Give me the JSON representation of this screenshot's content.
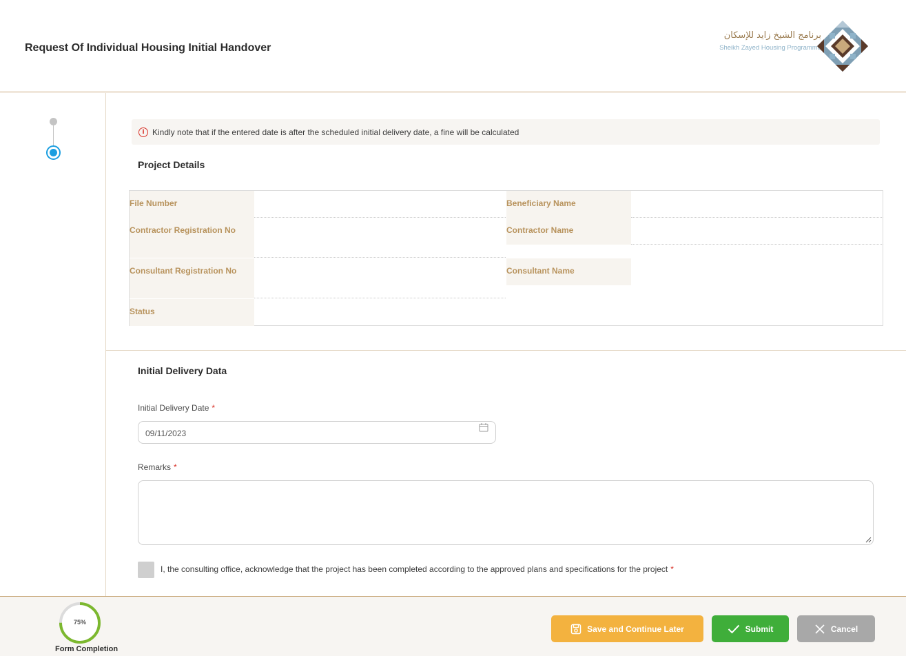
{
  "header": {
    "title": "Request Of Individual Housing Initial Handover",
    "logo_arabic": "برنامج الشيخ زايد للإسكان",
    "logo_english": "Sheikh Zayed Housing Programme"
  },
  "stepper": {
    "steps": [
      "step-1",
      "step-2"
    ],
    "current": 2
  },
  "notice": {
    "text": "Kindly note that if the entered date is after the scheduled initial delivery date, a fine will be calculated",
    "icon": "info-icon"
  },
  "project_details": {
    "title": "Project Details",
    "fields": {
      "file_number": {
        "label": "File Number",
        "value": ""
      },
      "beneficiary_name": {
        "label": "Beneficiary Name",
        "value": ""
      },
      "contractor_registration_no": {
        "label": "Contractor Registration No",
        "value": ""
      },
      "contractor_name": {
        "label": "Contractor Name",
        "value": ""
      },
      "consultant_registration_no": {
        "label": "Consultant Registration No",
        "value": ""
      },
      "consultant_name": {
        "label": "Consultant Name",
        "value": ""
      },
      "status": {
        "label": "Status",
        "value": ""
      }
    }
  },
  "initial_delivery": {
    "title": "Initial Delivery Data",
    "date_label": "Initial Delivery Date",
    "date_value": "09/11/2023",
    "remarks_label": "Remarks",
    "remarks_value": "",
    "required_mark": "*",
    "acknowledge_text": "I, the consulting office, acknowledge that the project has been completed according to the approved plans and specifications for the project",
    "acknowledge_checked": false
  },
  "footer": {
    "progress_percent": 75,
    "progress_label": "75%",
    "progress_caption": "Form Completion",
    "save_label": "Save and Continue Later",
    "submit_label": "Submit",
    "cancel_label": "Cancel"
  },
  "colors": {
    "accent_gold": "#b8935d",
    "primary_blue": "#1a9ee0",
    "save_orange": "#f3b23f",
    "submit_green": "#3fae3a",
    "cancel_gray": "#a8a8a8",
    "required_red": "#d9342b"
  }
}
